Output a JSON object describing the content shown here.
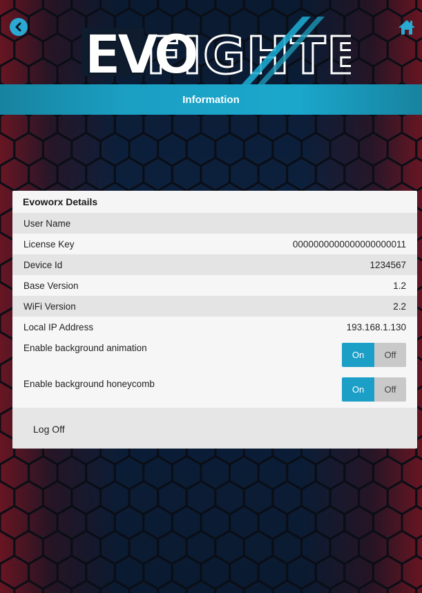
{
  "header": {
    "title": "Information",
    "logo_text": "EVOFIGHTER"
  },
  "icons": {
    "back": "chevron-left-circle-icon",
    "home": "home-icon"
  },
  "colors": {
    "accent": "#1ba7cc",
    "toggle_on": "#1c9fc7",
    "toggle_off": "#c9c9c9",
    "panel_bg": "#f2f2f2"
  },
  "panel": {
    "title": "Evoworx Details",
    "rows": [
      {
        "label": "User Name",
        "value": ""
      },
      {
        "label": "License Key",
        "value": "0000000000000000000011"
      },
      {
        "label": "Device Id",
        "value": "1234567"
      },
      {
        "label": "Base Version",
        "value": "1.2"
      },
      {
        "label": "WiFi Version",
        "value": "2.2"
      },
      {
        "label": "Local IP Address",
        "value": "193.168.1.130"
      }
    ],
    "toggles": [
      {
        "label": "Enable background animation",
        "on_label": "On",
        "off_label": "Off",
        "state": "On"
      },
      {
        "label": "Enable background honeycomb",
        "on_label": "On",
        "off_label": "Off",
        "state": "On"
      }
    ],
    "logoff_label": "Log Off"
  }
}
